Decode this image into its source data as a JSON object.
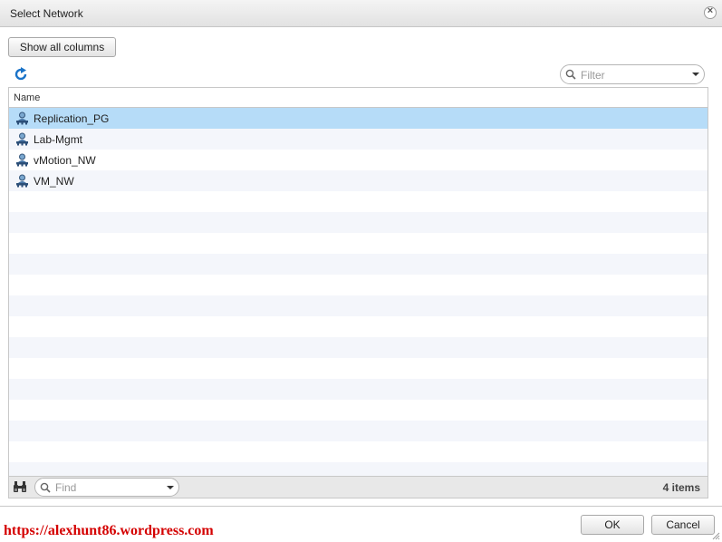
{
  "dialog": {
    "title": "Select Network",
    "close_icon": "close-icon"
  },
  "toolbar": {
    "show_all_columns_label": "Show all columns",
    "refresh_icon": "refresh-icon",
    "filter_placeholder": "Filter"
  },
  "grid": {
    "column_header": "Name",
    "selected_index": 0,
    "rows": [
      {
        "label": "Replication_PG",
        "icon": "network-portgroup-icon"
      },
      {
        "label": "Lab-Mgmt",
        "icon": "network-portgroup-icon"
      },
      {
        "label": "vMotion_NW",
        "icon": "network-portgroup-icon"
      },
      {
        "label": "VM_NW",
        "icon": "network-portgroup-icon"
      }
    ]
  },
  "footer": {
    "find_placeholder": "Find",
    "item_count": "4 items"
  },
  "buttons": {
    "ok_label": "OK",
    "cancel_label": "Cancel"
  },
  "watermark": "https://alexhunt86.wordpress.com",
  "colors": {
    "selection": "#b6dcf8",
    "row_alt": "#f4f6fb",
    "watermark": "#d40000",
    "refresh": "#1a73c8"
  }
}
